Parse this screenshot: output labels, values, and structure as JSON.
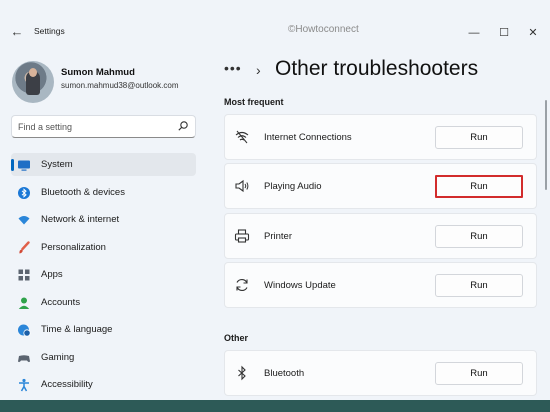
{
  "window": {
    "app_title": "Settings",
    "watermark": "©Howtoconnect",
    "controls": {
      "minimize": "—",
      "maximize": "☐",
      "close": "✕"
    },
    "back_glyph": "←"
  },
  "user": {
    "name": "Sumon Mahmud",
    "email": "sumon.mahmud38@outlook.com"
  },
  "search": {
    "placeholder": "Find a setting"
  },
  "sidebar": {
    "items": [
      {
        "label": "System",
        "icon": "monitor-icon",
        "selected": true
      },
      {
        "label": "Bluetooth & devices",
        "icon": "bluetooth-icon"
      },
      {
        "label": "Network & internet",
        "icon": "wifi-icon"
      },
      {
        "label": "Personalization",
        "icon": "brush-icon"
      },
      {
        "label": "Apps",
        "icon": "apps-icon"
      },
      {
        "label": "Accounts",
        "icon": "person-icon"
      },
      {
        "label": "Time & language",
        "icon": "globe-clock-icon"
      },
      {
        "label": "Gaming",
        "icon": "gamepad-icon"
      },
      {
        "label": "Accessibility",
        "icon": "accessibility-icon"
      }
    ]
  },
  "main": {
    "breadcrumb_dots": "•••",
    "breadcrumb_chevron": "›",
    "title": "Other troubleshooters",
    "sections": [
      {
        "label": "Most frequent",
        "rows": [
          {
            "label": "Internet Connections",
            "icon": "network-signal-icon",
            "button": "Run"
          },
          {
            "label": "Playing Audio",
            "icon": "speaker-icon",
            "button": "Run",
            "highlighted": true
          },
          {
            "label": "Printer",
            "icon": "printer-icon",
            "button": "Run"
          },
          {
            "label": "Windows Update",
            "icon": "refresh-icon",
            "button": "Run"
          }
        ]
      },
      {
        "label": "Other",
        "rows": [
          {
            "label": "Bluetooth",
            "icon": "bluetooth-icon",
            "button": "Run"
          }
        ]
      }
    ]
  },
  "colors": {
    "accent": "#0067c0",
    "highlight_border": "#d22c2c",
    "window_bg": "#f0f4f9",
    "taskbar_strip": "#2d5a57"
  }
}
